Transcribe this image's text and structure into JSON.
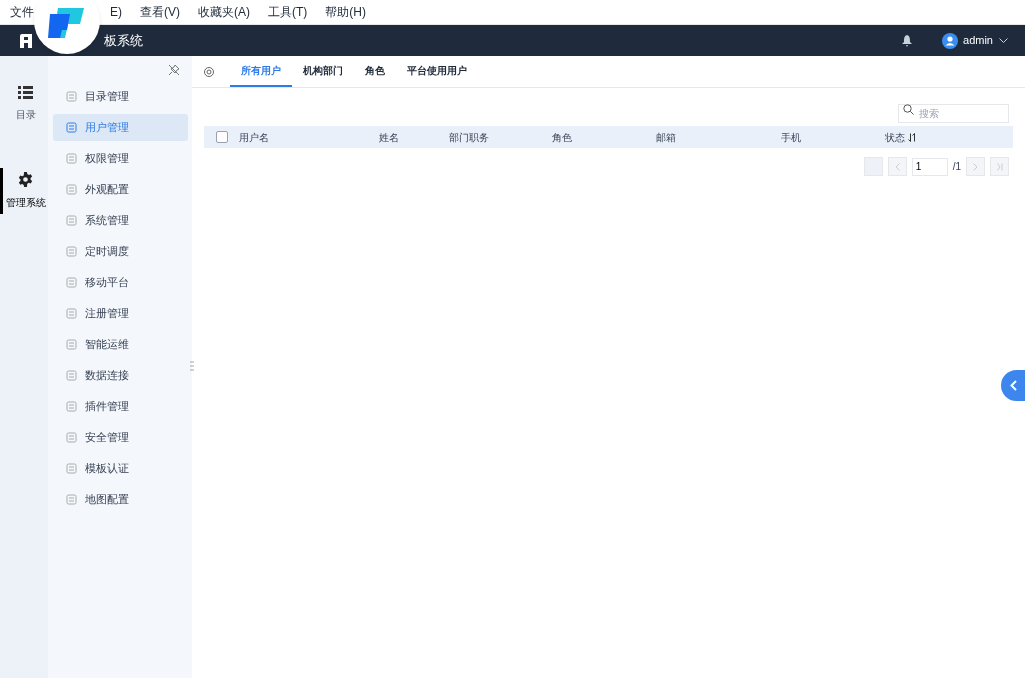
{
  "menu_bar": {
    "items": [
      "文件",
      "E)",
      "查看(V)",
      "收藏夹(A)",
      "工具(T)",
      "帮助(H)"
    ]
  },
  "header": {
    "title": "板系统",
    "user": "admin"
  },
  "rail": {
    "items": [
      {
        "label": "目录",
        "kind": "list",
        "selected": false
      },
      {
        "label": "管理系统",
        "kind": "gear",
        "selected": true
      }
    ]
  },
  "sidebar": {
    "items": [
      {
        "label": "目录管理",
        "selected": false
      },
      {
        "label": "用户管理",
        "selected": true
      },
      {
        "label": "权限管理",
        "selected": false
      },
      {
        "label": "外观配置",
        "selected": false
      },
      {
        "label": "系统管理",
        "selected": false
      },
      {
        "label": "定时调度",
        "selected": false
      },
      {
        "label": "移动平台",
        "selected": false
      },
      {
        "label": "注册管理",
        "selected": false
      },
      {
        "label": "智能运维",
        "selected": false
      },
      {
        "label": "数据连接",
        "selected": false
      },
      {
        "label": "插件管理",
        "selected": false
      },
      {
        "label": "安全管理",
        "selected": false
      },
      {
        "label": "模板认证",
        "selected": false
      },
      {
        "label": "地图配置",
        "selected": false
      }
    ]
  },
  "tabs": [
    {
      "label": "所有用户",
      "selected": true
    },
    {
      "label": "机构部门",
      "selected": false
    },
    {
      "label": "角色",
      "selected": false
    },
    {
      "label": "平台使用用户",
      "selected": false
    }
  ],
  "search": {
    "placeholder": "搜索"
  },
  "table": {
    "select_all_checked": false,
    "columns": [
      {
        "label": "用户名",
        "sortable": false
      },
      {
        "label": "姓名",
        "sortable": false
      },
      {
        "label": "部门职务",
        "sortable": false
      },
      {
        "label": "角色",
        "sortable": false
      },
      {
        "label": "邮箱",
        "sortable": false
      },
      {
        "label": "手机",
        "sortable": false
      },
      {
        "label": "状态",
        "sortable": true
      }
    ]
  },
  "pagination": {
    "page": "1",
    "total": "/1"
  }
}
